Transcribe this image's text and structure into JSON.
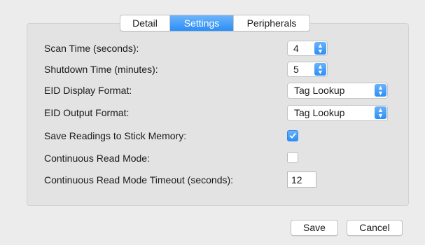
{
  "tabs": [
    {
      "label": "Detail",
      "active": false
    },
    {
      "label": "Settings",
      "active": true
    },
    {
      "label": "Peripherals",
      "active": false
    }
  ],
  "settings": {
    "scan_time": {
      "label": "Scan Time (seconds):",
      "value": "4"
    },
    "shutdown_time": {
      "label": "Shutdown Time (minutes):",
      "value": "5"
    },
    "eid_display_format": {
      "label": "EID Display Format:",
      "value": "Tag Lookup"
    },
    "eid_output_format": {
      "label": "EID Output Format:",
      "value": "Tag Lookup"
    },
    "save_readings": {
      "label": "Save Readings to Stick Memory:",
      "checked": true
    },
    "continuous_read": {
      "label": "Continuous Read Mode:",
      "checked": false
    },
    "continuous_timeout": {
      "label": "Continuous Read Mode Timeout (seconds):",
      "value": "12"
    }
  },
  "buttons": {
    "save": "Save",
    "cancel": "Cancel"
  },
  "colors": {
    "accent": "#2a8ff7",
    "window_bg": "#ececec",
    "panel_bg": "#e3e3e3"
  }
}
